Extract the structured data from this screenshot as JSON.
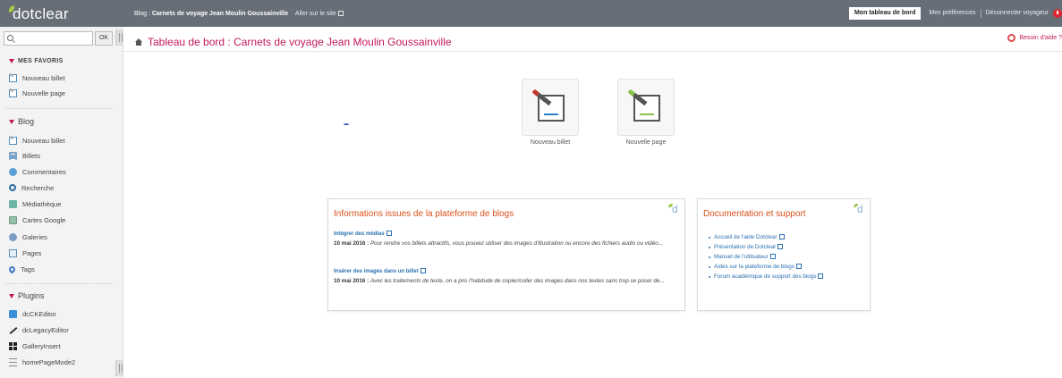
{
  "topbar": {
    "logo": "dotclear",
    "blog_prefix": "Blog :",
    "blog_name": "Carnets de voyage Jean Moulin Goussainville",
    "visit_site": "Aller sur le site",
    "dashboard": "Mon tableau de bord",
    "preferences": "Mes préférences",
    "logout": "Déconnecter voyageur"
  },
  "search": {
    "placeholder": "",
    "ok": "OK"
  },
  "sidebar": {
    "favorites_title": "Mes favoris",
    "favorites": [
      {
        "label": "Nouveau billet",
        "icon": "new-post-icon"
      },
      {
        "label": "Nouvelle page",
        "icon": "new-page-icon"
      }
    ],
    "blog_title": "Blog",
    "blog_items": [
      {
        "label": "Nouveau billet",
        "icon": "new-post-icon"
      },
      {
        "label": "Billets",
        "icon": "posts-icon"
      },
      {
        "label": "Commentaires",
        "icon": "comments-icon"
      },
      {
        "label": "Recherche",
        "icon": "search-icon"
      },
      {
        "label": "Médiathèque",
        "icon": "media-icon"
      },
      {
        "label": "Cartes Google",
        "icon": "map-icon"
      },
      {
        "label": "Galeries",
        "icon": "galleries-icon"
      },
      {
        "label": "Pages",
        "icon": "pages-icon"
      },
      {
        "label": "Tags",
        "icon": "tags-icon"
      }
    ],
    "plugins_title": "Plugins",
    "plugins": [
      {
        "label": "dcCKEditor",
        "icon": "ckeditor-icon"
      },
      {
        "label": "dcLegacyEditor",
        "icon": "pen-icon"
      },
      {
        "label": "GalleryInsert",
        "icon": "grid-icon"
      },
      {
        "label": "homePageMode2",
        "icon": "lines-icon"
      }
    ]
  },
  "main": {
    "title": "Tableau de bord : Carnets de voyage Jean Moulin Goussainville",
    "help": "Besoin d'aide ?",
    "quick_actions": [
      {
        "label": "Nouveau billet",
        "icon": "new-post-icon",
        "color": "#2b7fc6"
      },
      {
        "label": "Nouvelle page",
        "icon": "new-page-icon",
        "color": "#8bc34a"
      }
    ],
    "news": {
      "title": "Informations issues de la plateforme de blogs",
      "items": [
        {
          "link": "Intégrer des médias",
          "date": "10 mai 2016 :",
          "text": "Pour rendre vos billets attractifs, vous pouvez utiliser des images d'illustration ou encore des fichiers audio ou vidéo..."
        },
        {
          "link": "Insérer des images dans un billet",
          "date": "10 mai 2016 :",
          "text": "Avec les traitements de texte, on a pris l'habitude de copier/coller des images dans nos textes sans trop se poser de..."
        }
      ]
    },
    "docs": {
      "title": "Documentation et support",
      "links": [
        "Accueil de l'aide Dotclear",
        "Présentation de Dotclear",
        "Manuel de l'utilisateur",
        "Aides sur la plateforme de blogs",
        "Forum académique de support des blogs"
      ]
    }
  },
  "colors": {
    "topbar": "#676e78",
    "accent": "#c2185b",
    "panel_title": "#d9501a",
    "link": "#2a6fb0"
  }
}
